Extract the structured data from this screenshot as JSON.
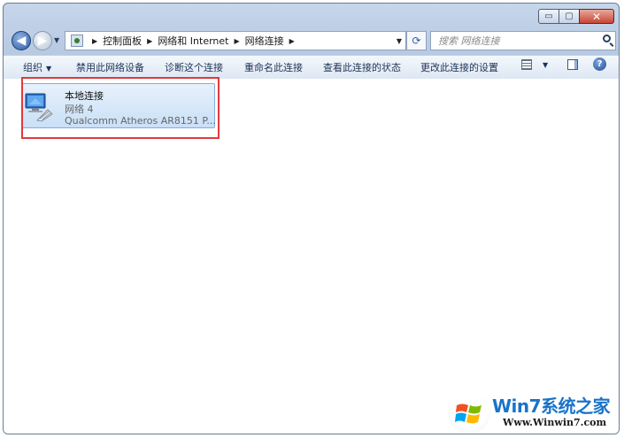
{
  "window": {
    "controls": {
      "minimize": "▭",
      "maximize": "▢",
      "close": "✕"
    }
  },
  "address": {
    "breadcrumb": [
      "控制面板",
      "网络和 Internet",
      "网络连接"
    ],
    "search_placeholder": "搜索 网络连接"
  },
  "toolbar": {
    "organize": "组织",
    "items": [
      "禁用此网络设备",
      "诊断这个连接",
      "重命名此连接",
      "查看此连接的状态",
      "更改此连接的设置"
    ],
    "help": "?"
  },
  "connection": {
    "name": "本地连接",
    "status": "网络  4",
    "device": "Qualcomm Atheros AR8151 P..."
  },
  "watermark": {
    "title": "Win7系统之家",
    "url": "Www.Winwin7.com"
  },
  "colors": {
    "selection_fill": "#cfe3f8",
    "selection_border": "#84acdd",
    "highlight_box": "#e0393e",
    "watermark_blue": "#1a73c9"
  }
}
